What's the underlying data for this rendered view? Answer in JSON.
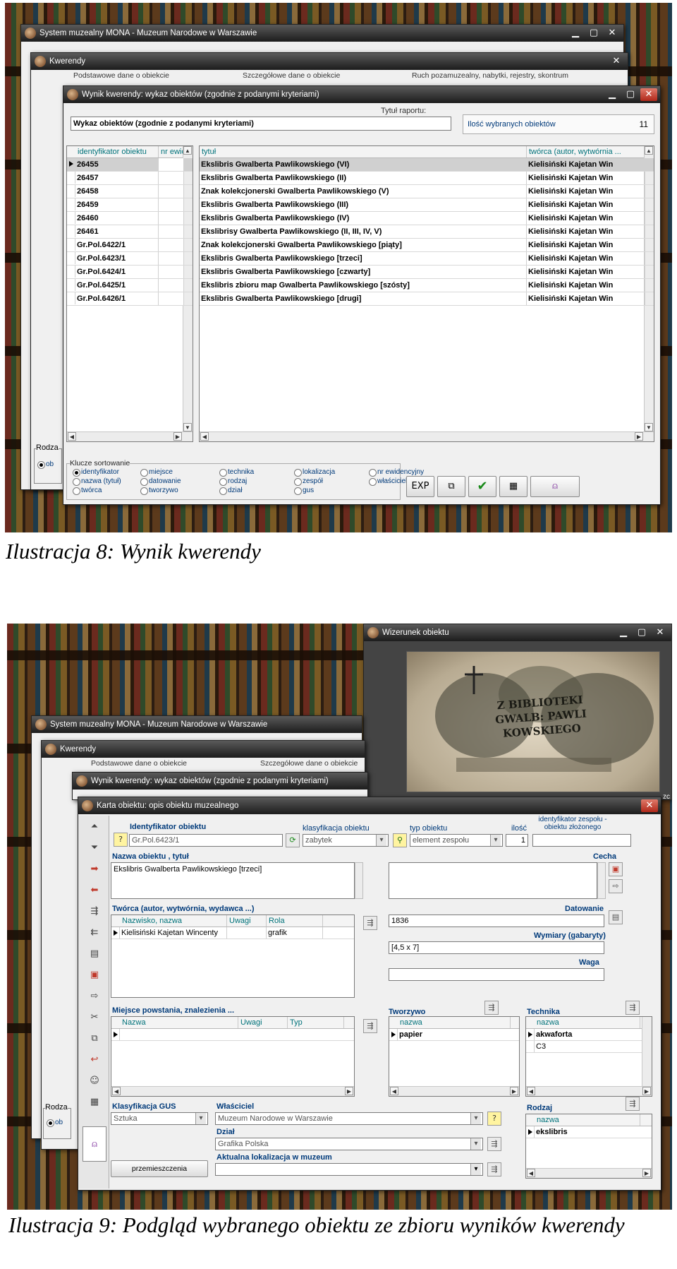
{
  "shot1": {
    "bg_windows": {
      "main_title": "System muzealny MONA   -   Muzeum Narodowe w Warszawie",
      "kwerendy_title": "Kwerendy",
      "tabs": [
        "Podstawowe dane o obiekcie",
        "Szczegółowe dane o obiekcie",
        "Ruch pozamuzealny, nabytki, rejestry, skontrum"
      ],
      "rodza_label": "Rodza",
      "ob_label": "ob"
    },
    "result_window": {
      "title": "Wynik kwerendy: wykaz obiektów  (zgodnie z podanymi kryteriami)",
      "report_title_label": "Tytuł raportu:",
      "report_title_value": "Wykaz obiektów (zgodnie z podanymi kryteriami)",
      "count_label": "Ilość wybranych obiektów",
      "count_value": "11",
      "left_headers": [
        "identyfikator obiektu",
        "nr ewid"
      ],
      "right_headers": [
        "tytuł",
        "twórca (autor, wytwórnia ..."
      ],
      "rows": [
        {
          "id": "26455",
          "title": "Ekslibris Gwalberta Pawlikowskiego (VI)",
          "creator": "Kielisiński Kajetan Win"
        },
        {
          "id": "26457",
          "title": "Ekslibris Gwalberta Pawlikowskiego (II)",
          "creator": "Kielisiński Kajetan Win"
        },
        {
          "id": "26458",
          "title": "Znak kolekcjonerski Gwalberta Pawlikowskiego (V)",
          "creator": "Kielisiński Kajetan Win"
        },
        {
          "id": "26459",
          "title": "Ekslibris Gwalberta Pawlikowskiego (III)",
          "creator": "Kielisiński Kajetan Win"
        },
        {
          "id": "26460",
          "title": "Ekslibris Gwalberta Pawlikowskiego (IV)",
          "creator": "Kielisiński Kajetan Win"
        },
        {
          "id": "26461",
          "title": "Ekslibrisy Gwalberta Pawlikowskiego (II, III, IV, V)",
          "creator": "Kielisiński Kajetan Win"
        },
        {
          "id": "Gr.Pol.6422/1",
          "title": "Znak kolekcjonerski Gwalberta Pawlikowskiego [piąty]",
          "creator": "Kielisiński Kajetan Win"
        },
        {
          "id": "Gr.Pol.6423/1",
          "title": "Ekslibris Gwalberta Pawlikowskiego [trzeci]",
          "creator": "Kielisiński Kajetan Win"
        },
        {
          "id": "Gr.Pol.6424/1",
          "title": "Ekslibris Gwalberta Pawlikowskiego [czwarty]",
          "creator": "Kielisiński Kajetan Win"
        },
        {
          "id": "Gr.Pol.6425/1",
          "title": "Ekslibris zbioru map Gwalberta Pawlikowskiego [szósty]",
          "creator": "Kielisiński Kajetan Win"
        },
        {
          "id": "Gr.Pol.6426/1",
          "title": "Ekslibris Gwalberta Pawlikowskiego [drugi]",
          "creator": "Kielisiński Kajetan Win"
        }
      ],
      "sort_group_label": "Klucze sortowanie",
      "sort_options": [
        [
          "identyfikator",
          "nazwa (tytuł)",
          "twórca"
        ],
        [
          "miejsce",
          "datowanie",
          "tworzywo"
        ],
        [
          "technika",
          "rodzaj",
          "dział"
        ],
        [
          "lokalizacja",
          "zespół",
          "gus"
        ],
        [
          "nr ewidencyjny",
          "właściciel"
        ]
      ],
      "sort_selected": "identyfikator",
      "toolbar": {
        "exp": "EXP"
      }
    }
  },
  "caption1": "Ilustracja 8: Wynik kwerendy",
  "shot2": {
    "image_window_title": "Wizerunek obiektu",
    "bookplate_lines": [
      "Z BIBLIOTEKI",
      "GWALB: PAWLI",
      "KOWSKIEGO"
    ],
    "bg_main_title": "System muzealny MONA   -   Muzeum Narodowe w Warszawie",
    "bg_kwerendy_title": "Kwerendy",
    "bg_tabs": [
      "Podstawowe dane o obiekcie",
      "Szczegółowe dane o obiekcie"
    ],
    "bg_result_title": "Wynik kwerendy: wykaz obiektów  (zgodnie z podanymi kryteriami)",
    "side_label": "zc",
    "bg_rodza": "Rodza",
    "bg_ob": "ob",
    "card": {
      "title": "Karta obiektu: opis obiektu muzealnego",
      "id_label": "Identyfikator obiektu",
      "id_value": "Gr.Pol.6423/1",
      "classification_label": "klasyfikacja obiektu",
      "classification_value": "zabytek",
      "type_label": "typ obiektu",
      "type_value": "element zespołu",
      "qty_label": "ilość",
      "qty_value": "1",
      "group_id_label": "identyfikator zespołu - obiektu złożonego",
      "name_label": "Nazwa obiektu , tytuł",
      "name_value": "Ekslibris Gwalberta Pawlikowskiego [trzeci]",
      "feature_label": "Cecha",
      "creator_label": "Twórca (autor, wytwórnia, wydawca ...)",
      "creator_headers": [
        "Nazwisko, nazwa",
        "Uwagi",
        "Rola"
      ],
      "creator_row": {
        "name": "Kielisiński Kajetan Wincenty",
        "notes": "",
        "role": "grafik"
      },
      "dating_label": "Datowanie",
      "dating_value": "1836",
      "dimensions_label": "Wymiary (gabaryty)",
      "dimensions_value": "[4,5 x 7]",
      "weight_label": "Waga",
      "place_label": "Miejsce powstania, znalezienia ...",
      "place_headers": [
        "Nazwa",
        "Uwagi",
        "Typ"
      ],
      "material_label": "Tworzywo",
      "material_header": "nazwa",
      "material_rows": [
        "papier"
      ],
      "technique_label": "Technika",
      "technique_header": "nazwa",
      "technique_rows": [
        "akwaforta",
        "C3"
      ],
      "gus_label": "Klasyfikacja GUS",
      "gus_value": "Sztuka",
      "owner_label": "Właściciel",
      "owner_value": "Muzeum Narodowe w Warszawie",
      "dept_label": "Dział",
      "dept_value": "Grafika Polska",
      "location_label": "Aktualna lokalizacja w muzeum",
      "kind_label": "Rodzaj",
      "kind_header": "nazwa",
      "kind_rows": [
        "ekslibris"
      ],
      "moves_button": "przemieszczenia"
    }
  },
  "caption2": "Ilustracja 9: Podgląd wybranego obiektu ze zbioru wyników kwerendy",
  "colors": {
    "label_blue": "#003a7a",
    "label_teal": "#00727a",
    "titlebar": "#2a2a2a",
    "close_red": "#c0392b"
  }
}
